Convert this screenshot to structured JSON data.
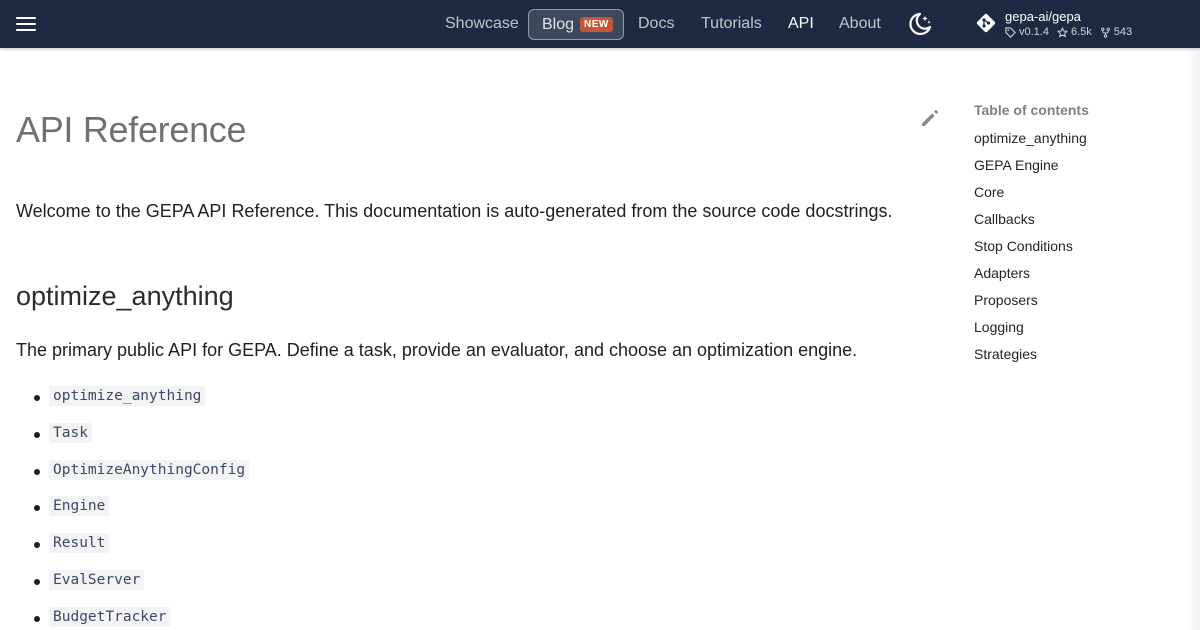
{
  "header": {
    "nav": {
      "showcase": "Showcase",
      "blog": "Blog",
      "blog_badge": "NEW",
      "docs": "Docs",
      "tutorials": "Tutorials",
      "api": "API",
      "about": "About"
    },
    "active_tab": "API",
    "repo": {
      "name": "gepa-ai/gepa",
      "version": "v0.1.4",
      "stars": "6.5k",
      "forks": "543"
    },
    "icons": [
      "menu-icon",
      "theme-toggle-icon",
      "git-icon",
      "tag-icon",
      "star-icon",
      "fork-icon"
    ]
  },
  "page": {
    "title": "API Reference",
    "intro": "Welcome to the GEPA API Reference. This documentation is auto-generated from the source code docstrings.",
    "section": {
      "heading": "optimize_anything",
      "description": "The primary public API for GEPA. Define a task, provide an evaluator, and choose an optimization engine.",
      "items": [
        "optimize_anything",
        "Task",
        "OptimizeAnythingConfig",
        "Engine",
        "Result",
        "EvalServer",
        "BudgetTracker"
      ]
    }
  },
  "toc": {
    "title": "Table of contents",
    "items": [
      "optimize_anything",
      "GEPA Engine",
      "Core",
      "Callbacks",
      "Stop Conditions",
      "Adapters",
      "Proposers",
      "Logging",
      "Strategies"
    ]
  },
  "colors": {
    "header_bg": "#1e2a44",
    "badge": "#c2573a",
    "code_text": "#3a4a66",
    "code_bg": "#f3f3f5"
  }
}
